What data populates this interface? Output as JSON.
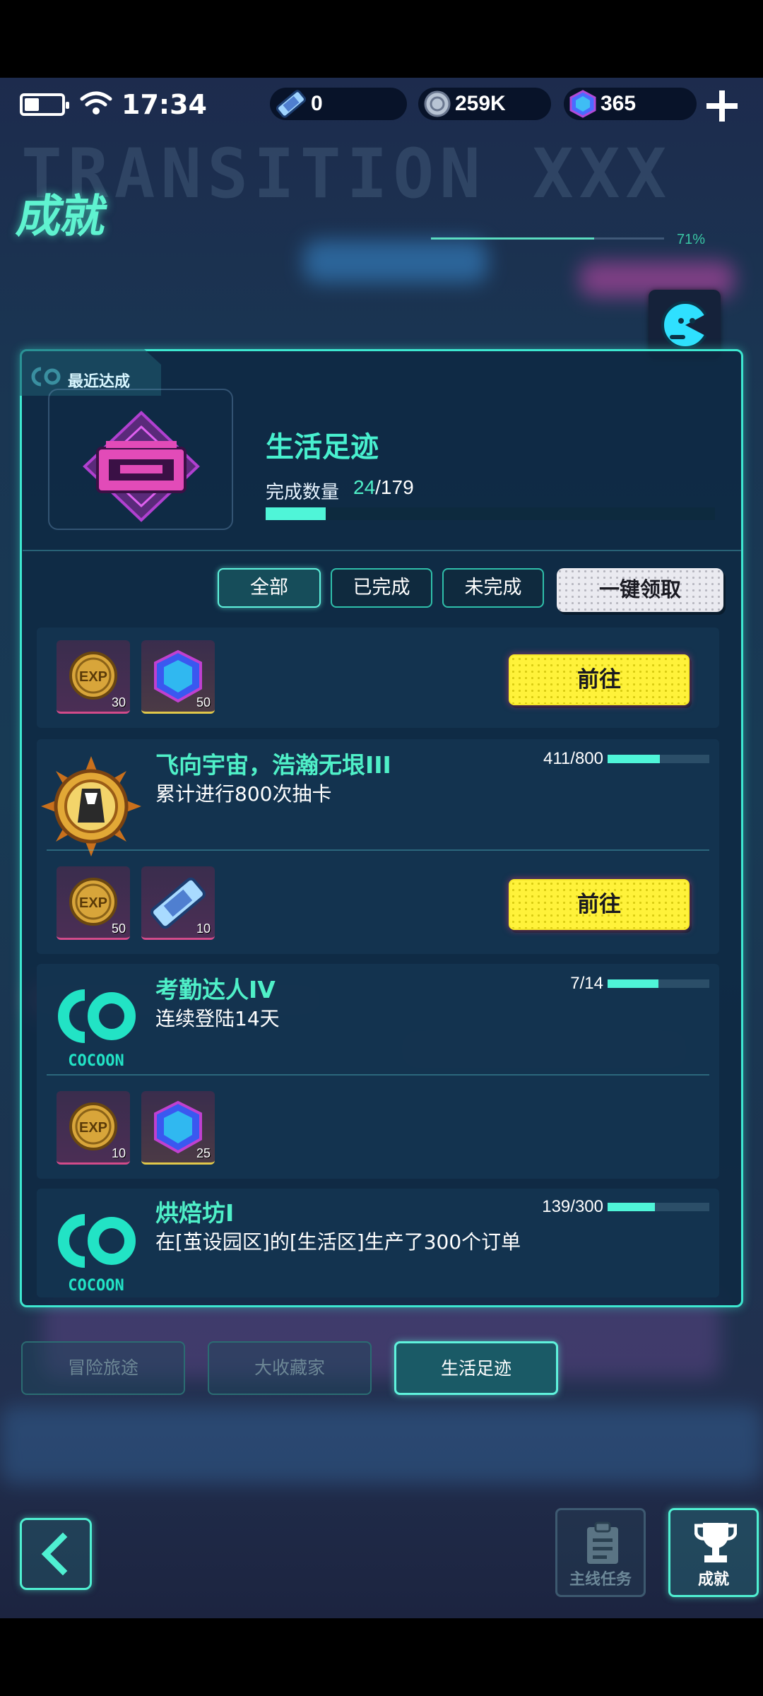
{
  "status_bar": {
    "time": "17:34"
  },
  "currencies": {
    "tickets": "0",
    "coins": "259K",
    "gems": "365"
  },
  "header": {
    "title": "成就",
    "progress_text": "71%"
  },
  "recent": {
    "label": "最近达成",
    "name": "生活足迹",
    "count_label": "完成数量",
    "count_done": "24",
    "count_total": "/179",
    "progress_fraction": 0.134
  },
  "filters": {
    "all": "全部",
    "completed": "已完成",
    "incomplete": "未完成",
    "claim_all": "一键领取"
  },
  "achievements": [
    {
      "title": "",
      "desc": "",
      "rewards": [
        {
          "icon": "exp-coin-icon",
          "qty": "30"
        },
        {
          "icon": "gem-icon",
          "qty": "50"
        }
      ],
      "action": "前往"
    },
    {
      "title": "飞向宇宙，浩瀚无垠III",
      "desc": "累计进行800次抽卡",
      "progress": "411/800",
      "progress_fraction": 0.514,
      "rewards": [
        {
          "icon": "exp-coin-icon",
          "qty": "50"
        },
        {
          "icon": "ticket-icon",
          "qty": "10"
        }
      ],
      "action": "前往"
    },
    {
      "title": "考勤达人IV",
      "desc": "连续登陆14天",
      "progress": "7/14",
      "progress_fraction": 0.5,
      "logo": "COCOON",
      "rewards": [
        {
          "icon": "exp-coin-icon",
          "qty": "10"
        },
        {
          "icon": "gem-icon",
          "qty": "25"
        }
      ]
    },
    {
      "title": "烘焙坊I",
      "desc": "在[茧设园区]的[生活区]生产了300个订单",
      "progress": "139/300",
      "progress_fraction": 0.463,
      "logo": "COCOON"
    }
  ],
  "categories": [
    "冒险旅途",
    "大收藏家",
    "生活足迹"
  ],
  "bottom_nav": {
    "main_quest": "主线任务",
    "achievements": "成就"
  },
  "colors": {
    "accent": "#4ff0c8",
    "go_button": "#fff23a",
    "panel_border": "#3de7d0"
  }
}
